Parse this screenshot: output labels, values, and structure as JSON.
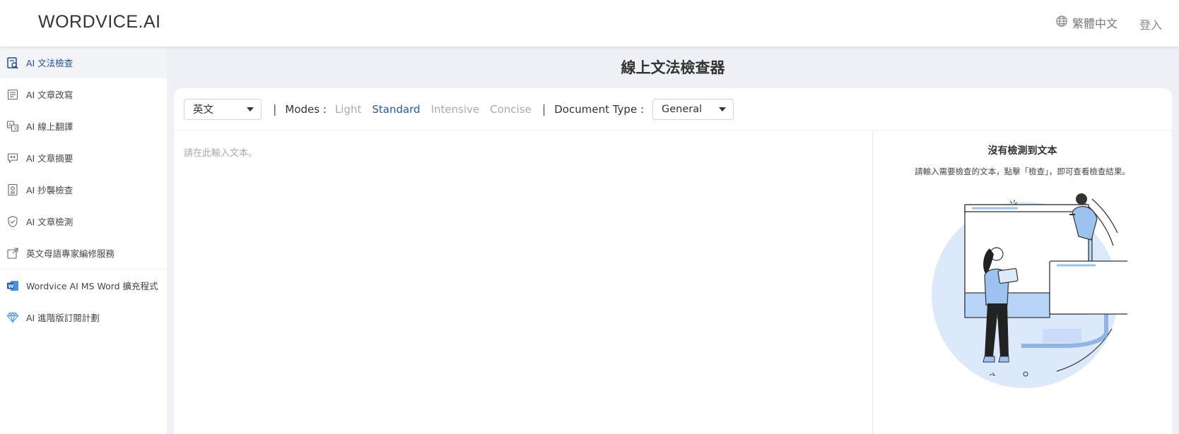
{
  "header": {
    "logo": "WORDVICE.AI",
    "language": "繁體中文",
    "login": "登入"
  },
  "sidebar": {
    "items": [
      {
        "label": "AI 文法檢查",
        "icon": "grammar-check-icon",
        "active": true
      },
      {
        "label": "AI 文章改寫",
        "icon": "rewrite-icon"
      },
      {
        "label": "AI 線上翻譯",
        "icon": "translate-icon"
      },
      {
        "label": "AI 文章摘要",
        "icon": "summary-icon"
      },
      {
        "label": "AI 抄襲檢查",
        "icon": "plagiarism-icon"
      },
      {
        "label": "AI 文章檢測",
        "icon": "ai-detector-icon"
      },
      {
        "label": "英文母語專家編修服務",
        "icon": "external-link-icon"
      },
      {
        "label": "Wordvice AI MS Word 擴充程式",
        "icon": "ms-word-icon"
      },
      {
        "label": "AI 進階版訂閱計劃",
        "icon": "diamond-icon"
      }
    ]
  },
  "main": {
    "title": "線上文法檢查器"
  },
  "toolbar": {
    "language_value": "英文",
    "separator": "|",
    "modes_label": "Modes :",
    "modes": [
      "Light",
      "Standard",
      "Intensive",
      "Concise"
    ],
    "active_mode": "Standard",
    "doc_type_label": "Document Type :",
    "doc_type_value": "General"
  },
  "editor": {
    "placeholder": "請在此輸入文本。"
  },
  "result": {
    "title": "沒有檢測到文本",
    "description": "請輸入需要檢查的文本，點擊「檢查」，即可查看檢查結果。"
  },
  "colors": {
    "accent": "#2a5a9a",
    "illustration_blue": "#9cc2ef",
    "background": "#eef0f5"
  }
}
